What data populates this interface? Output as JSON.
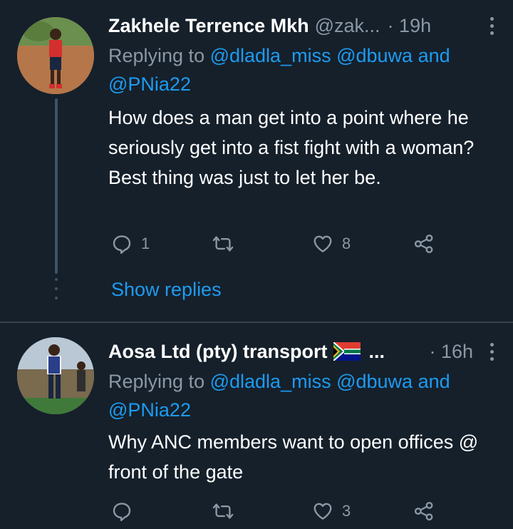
{
  "tweets": [
    {
      "name": "Zakhele Terrence Mkh",
      "handle": "@zak...",
      "time": "· 19h",
      "replying_prefix": "Replying to ",
      "mention1": "@dladla_miss",
      "mention2": "@dbuwa",
      "and_text": " and ",
      "mention3": "@PNia22",
      "text": "How does a man get into a point where he seriously get into a fist fight with a woman? Best thing was just to let her be.",
      "reply_count": "1",
      "retweet_count": "",
      "like_count": "8",
      "show_replies": "Show replies"
    },
    {
      "name": "Aosa Ltd (pty) transport",
      "ellipsis": "...",
      "time": "· 16h",
      "replying_prefix": "Replying to ",
      "mention1": "@dladla_miss",
      "mention2": "@dbuwa",
      "and_text": " and ",
      "mention3": "@PNia22",
      "text": "Why ANC members want to open offices @ front of the gate",
      "reply_count": "",
      "retweet_count": "",
      "like_count": "3"
    }
  ],
  "icons": {
    "reply": "reply-icon",
    "retweet": "retweet-icon",
    "like": "heart-icon",
    "share": "share-icon",
    "more": "more-icon",
    "flag": "south-africa-flag-icon"
  },
  "colors": {
    "background": "#15202b",
    "text": "#ffffff",
    "muted": "#8b98a5",
    "link": "#1d9bf0",
    "divider": "#38444d"
  }
}
